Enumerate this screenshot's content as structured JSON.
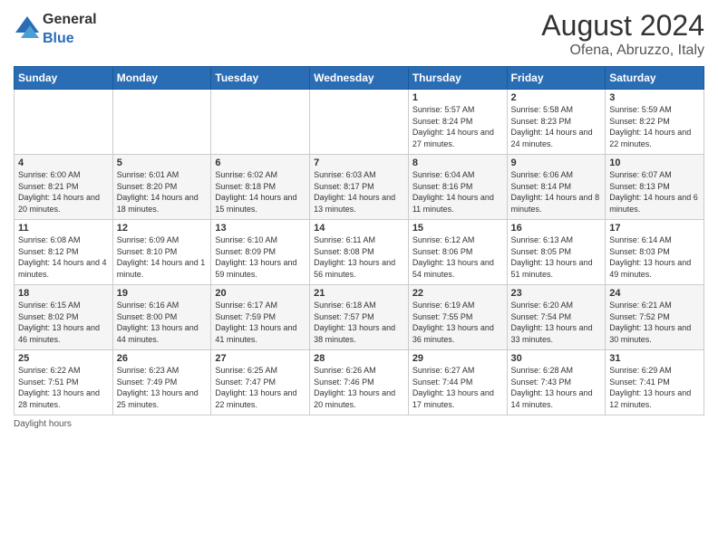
{
  "header": {
    "logo_general": "General",
    "logo_blue": "Blue",
    "month_year": "August 2024",
    "location": "Ofena, Abruzzo, Italy"
  },
  "days_of_week": [
    "Sunday",
    "Monday",
    "Tuesday",
    "Wednesday",
    "Thursday",
    "Friday",
    "Saturday"
  ],
  "weeks": [
    [
      {
        "day": "",
        "info": ""
      },
      {
        "day": "",
        "info": ""
      },
      {
        "day": "",
        "info": ""
      },
      {
        "day": "",
        "info": ""
      },
      {
        "day": "1",
        "info": "Sunrise: 5:57 AM\nSunset: 8:24 PM\nDaylight: 14 hours and 27 minutes."
      },
      {
        "day": "2",
        "info": "Sunrise: 5:58 AM\nSunset: 8:23 PM\nDaylight: 14 hours and 24 minutes."
      },
      {
        "day": "3",
        "info": "Sunrise: 5:59 AM\nSunset: 8:22 PM\nDaylight: 14 hours and 22 minutes."
      }
    ],
    [
      {
        "day": "4",
        "info": "Sunrise: 6:00 AM\nSunset: 8:21 PM\nDaylight: 14 hours and 20 minutes."
      },
      {
        "day": "5",
        "info": "Sunrise: 6:01 AM\nSunset: 8:20 PM\nDaylight: 14 hours and 18 minutes."
      },
      {
        "day": "6",
        "info": "Sunrise: 6:02 AM\nSunset: 8:18 PM\nDaylight: 14 hours and 15 minutes."
      },
      {
        "day": "7",
        "info": "Sunrise: 6:03 AM\nSunset: 8:17 PM\nDaylight: 14 hours and 13 minutes."
      },
      {
        "day": "8",
        "info": "Sunrise: 6:04 AM\nSunset: 8:16 PM\nDaylight: 14 hours and 11 minutes."
      },
      {
        "day": "9",
        "info": "Sunrise: 6:06 AM\nSunset: 8:14 PM\nDaylight: 14 hours and 8 minutes."
      },
      {
        "day": "10",
        "info": "Sunrise: 6:07 AM\nSunset: 8:13 PM\nDaylight: 14 hours and 6 minutes."
      }
    ],
    [
      {
        "day": "11",
        "info": "Sunrise: 6:08 AM\nSunset: 8:12 PM\nDaylight: 14 hours and 4 minutes."
      },
      {
        "day": "12",
        "info": "Sunrise: 6:09 AM\nSunset: 8:10 PM\nDaylight: 14 hours and 1 minute."
      },
      {
        "day": "13",
        "info": "Sunrise: 6:10 AM\nSunset: 8:09 PM\nDaylight: 13 hours and 59 minutes."
      },
      {
        "day": "14",
        "info": "Sunrise: 6:11 AM\nSunset: 8:08 PM\nDaylight: 13 hours and 56 minutes."
      },
      {
        "day": "15",
        "info": "Sunrise: 6:12 AM\nSunset: 8:06 PM\nDaylight: 13 hours and 54 minutes."
      },
      {
        "day": "16",
        "info": "Sunrise: 6:13 AM\nSunset: 8:05 PM\nDaylight: 13 hours and 51 minutes."
      },
      {
        "day": "17",
        "info": "Sunrise: 6:14 AM\nSunset: 8:03 PM\nDaylight: 13 hours and 49 minutes."
      }
    ],
    [
      {
        "day": "18",
        "info": "Sunrise: 6:15 AM\nSunset: 8:02 PM\nDaylight: 13 hours and 46 minutes."
      },
      {
        "day": "19",
        "info": "Sunrise: 6:16 AM\nSunset: 8:00 PM\nDaylight: 13 hours and 44 minutes."
      },
      {
        "day": "20",
        "info": "Sunrise: 6:17 AM\nSunset: 7:59 PM\nDaylight: 13 hours and 41 minutes."
      },
      {
        "day": "21",
        "info": "Sunrise: 6:18 AM\nSunset: 7:57 PM\nDaylight: 13 hours and 38 minutes."
      },
      {
        "day": "22",
        "info": "Sunrise: 6:19 AM\nSunset: 7:55 PM\nDaylight: 13 hours and 36 minutes."
      },
      {
        "day": "23",
        "info": "Sunrise: 6:20 AM\nSunset: 7:54 PM\nDaylight: 13 hours and 33 minutes."
      },
      {
        "day": "24",
        "info": "Sunrise: 6:21 AM\nSunset: 7:52 PM\nDaylight: 13 hours and 30 minutes."
      }
    ],
    [
      {
        "day": "25",
        "info": "Sunrise: 6:22 AM\nSunset: 7:51 PM\nDaylight: 13 hours and 28 minutes."
      },
      {
        "day": "26",
        "info": "Sunrise: 6:23 AM\nSunset: 7:49 PM\nDaylight: 13 hours and 25 minutes."
      },
      {
        "day": "27",
        "info": "Sunrise: 6:25 AM\nSunset: 7:47 PM\nDaylight: 13 hours and 22 minutes."
      },
      {
        "day": "28",
        "info": "Sunrise: 6:26 AM\nSunset: 7:46 PM\nDaylight: 13 hours and 20 minutes."
      },
      {
        "day": "29",
        "info": "Sunrise: 6:27 AM\nSunset: 7:44 PM\nDaylight: 13 hours and 17 minutes."
      },
      {
        "day": "30",
        "info": "Sunrise: 6:28 AM\nSunset: 7:43 PM\nDaylight: 13 hours and 14 minutes."
      },
      {
        "day": "31",
        "info": "Sunrise: 6:29 AM\nSunset: 7:41 PM\nDaylight: 13 hours and 12 minutes."
      }
    ]
  ],
  "footer": {
    "note": "Daylight hours"
  }
}
